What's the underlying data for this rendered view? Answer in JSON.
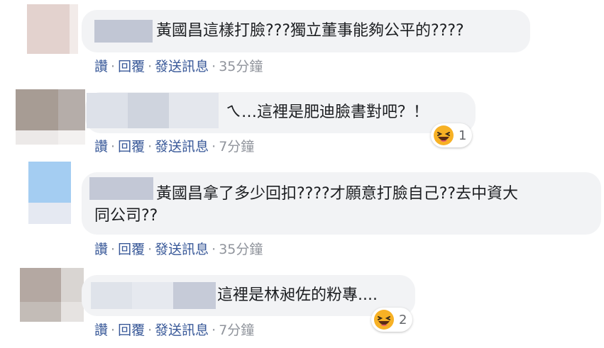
{
  "colors": {
    "link": "#385898",
    "meta": "#90949c",
    "bubble": "#f2f3f5",
    "text": "#1c1e21",
    "haha_yellow": "#f7b125"
  },
  "comments": [
    {
      "text": "黃國昌這樣打臉???獨立董事能夠公平的????",
      "actions": {
        "like": "讚",
        "sep": "·",
        "reply": "回覆",
        "message": "發送訊息",
        "time": "35分鐘"
      }
    },
    {
      "text": "ㄟ…這裡是肥迪臉書對吧？！",
      "actions": {
        "like": "讚",
        "sep": "·",
        "reply": "回覆",
        "message": "發送訊息",
        "time": "7分鐘"
      },
      "reaction": {
        "icon": "haha-emoji-icon",
        "count": "1"
      }
    },
    {
      "text_line1": "黃國昌拿了多少回扣????才願意打臉自己??去中資大",
      "text_line2": "同公司??",
      "actions": {
        "like": "讚",
        "sep": "·",
        "reply": "回覆",
        "message": "發送訊息",
        "time": "35分鐘"
      }
    },
    {
      "text": "這裡是林昶佐的粉專....",
      "actions": {
        "like": "讚",
        "sep": "·",
        "reply": "回覆",
        "message": "發送訊息",
        "time": "7分鐘"
      },
      "reaction": {
        "icon": "haha-emoji-icon",
        "count": "2"
      }
    }
  ]
}
